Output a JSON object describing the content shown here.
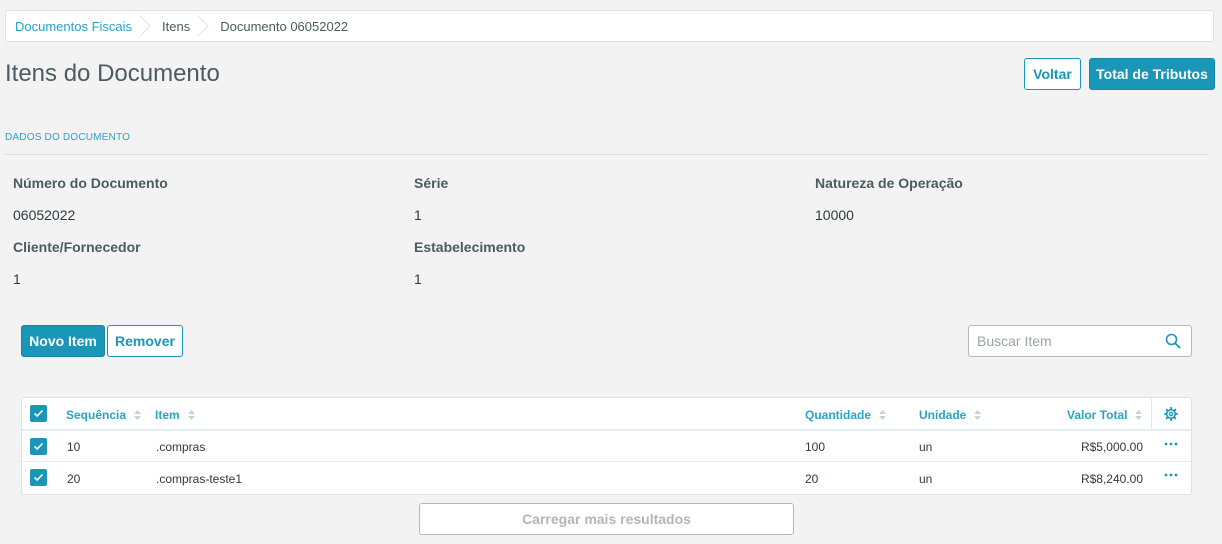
{
  "breadcrumb": {
    "items": [
      "Documentos Fiscais",
      "Itens",
      "Documento 06052022"
    ]
  },
  "page": {
    "title": "Itens do Documento",
    "back_label": "Voltar",
    "taxes_label": "Total de Tributos"
  },
  "section": {
    "title": "DADOS DO DOCUMENTO"
  },
  "fields": {
    "numero_label": "Número do Documento",
    "numero_value": "06052022",
    "serie_label": "Série",
    "serie_value": "1",
    "natureza_label": "Natureza de Operação",
    "natureza_value": "10000",
    "cliente_label": "Cliente/Fornecedor",
    "cliente_value": "1",
    "estab_label": "Estabelecimento",
    "estab_value": "1"
  },
  "actions": {
    "new_label": "Novo Item",
    "remove_label": "Remover",
    "search_placeholder": "Buscar Item"
  },
  "table": {
    "headers": [
      "Sequência",
      "Item",
      "Quantidade",
      "Unidade",
      "Valor Total"
    ],
    "rows": [
      {
        "seq": "10",
        "item": ".compras",
        "qty": "100",
        "unit": "un",
        "total": "R$5,000.00",
        "checked": true
      },
      {
        "seq": "20",
        "item": ".compras-teste1",
        "qty": "20",
        "unit": "un",
        "total": "R$8,240.00",
        "checked": true
      }
    ]
  },
  "load_more_label": "Carregar mais resultados",
  "colors": {
    "accent": "#1996b8",
    "link": "#29a3c7",
    "background": "#f3f3f3"
  }
}
